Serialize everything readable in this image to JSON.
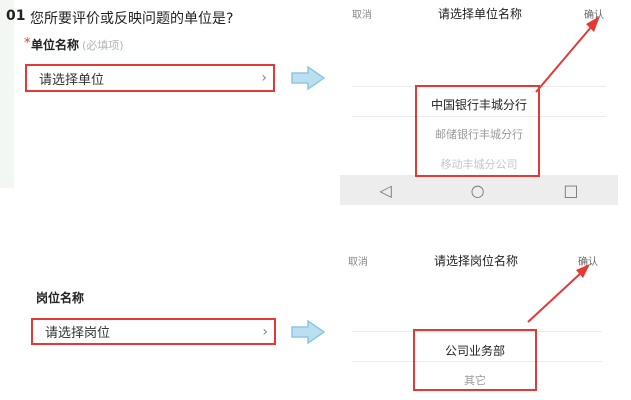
{
  "question": {
    "number": "01",
    "text": "您所要评价或反映问题的单位是?"
  },
  "section1": {
    "required_mark": "*",
    "label": "单位名称",
    "hint": "(必填项)",
    "select_placeholder": "请选择单位"
  },
  "picker1": {
    "cancel": "取消",
    "title": "请选择单位名称",
    "confirm": "确认",
    "options": [
      "中国银行丰城分行",
      "邮储银行丰城分行",
      "移动丰城分公司"
    ]
  },
  "section2": {
    "label": "岗位名称",
    "select_placeholder": "请选择岗位"
  },
  "picker2": {
    "cancel": "取消",
    "title": "请选择岗位名称",
    "confirm": "确认",
    "options": [
      "公司业务部",
      "其它"
    ]
  },
  "icons": {
    "chevron": "chevron-right-icon",
    "right_arrow": "right-arrow-icon",
    "nav_back": "triangle-back-icon",
    "nav_home": "circle-home-icon",
    "nav_recent": "square-recent-icon"
  },
  "colors": {
    "highlight": "#e53935",
    "arrow_fill": "#b9dff0",
    "arrow_stroke": "#8cc7e3"
  }
}
